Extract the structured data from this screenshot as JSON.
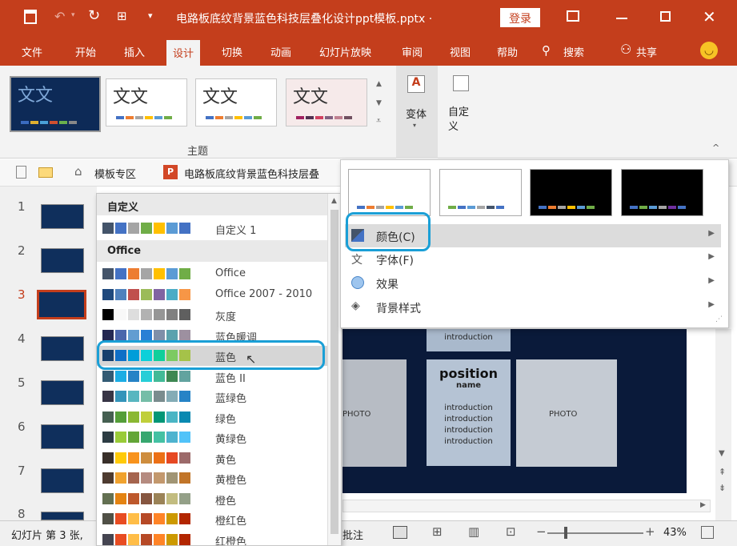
{
  "title": {
    "filename": "电路板底纹背景蓝色科技层叠化设计ppt模板.pptx ·",
    "login": "登录"
  },
  "ribbon_tabs": [
    "文件",
    "开始",
    "插入",
    "设计",
    "切换",
    "动画",
    "幻灯片放映",
    "审阅",
    "视图",
    "帮助",
    "搜索",
    "共享"
  ],
  "ribbon": {
    "group_label": "主题",
    "themes": [
      {
        "text": "文文"
      },
      {
        "text": "文文"
      },
      {
        "text": "文文"
      },
      {
        "text": "文文"
      }
    ],
    "variant_label": "变体",
    "customize_label": "自定义"
  },
  "docbar": {
    "template_zone": "模板专区",
    "doc_title": "电路板底纹背景蓝色科技层叠"
  },
  "slides": [
    "1",
    "2",
    "3",
    "4",
    "5",
    "6",
    "7",
    "8"
  ],
  "statusbar": {
    "slide_info": "幻灯片 第 3 张,",
    "notes": "批注",
    "zoom": "43%"
  },
  "color_menu": {
    "section_custom": "自定义",
    "custom_item": "自定义 1",
    "section_office": "Office",
    "items": [
      {
        "label": "Office",
        "colors": [
          "#44546a",
          "#4472c4",
          "#ed7d31",
          "#a5a5a5",
          "#ffc000",
          "#5b9bd5",
          "#70ad47"
        ]
      },
      {
        "label": "Office 2007 - 2010",
        "colors": [
          "#1f497d",
          "#4f81bd",
          "#c0504d",
          "#9bbb59",
          "#8064a2",
          "#4bacc6",
          "#f79646"
        ]
      },
      {
        "label": "灰度",
        "colors": [
          "#000000",
          "#f8f8f8",
          "#dddddd",
          "#b2b2b2",
          "#969696",
          "#808080",
          "#5f5f5f"
        ]
      },
      {
        "label": "蓝色暖调",
        "colors": [
          "#242852",
          "#4a66ac",
          "#629dd1",
          "#297fd5",
          "#7f8fa9",
          "#5aa2ae",
          "#9d90a0"
        ]
      },
      {
        "label": "蓝色",
        "colors": [
          "#17406d",
          "#0f6fc6",
          "#009dd9",
          "#0bd0d9",
          "#10cf9b",
          "#7cca62",
          "#a5c249"
        ]
      },
      {
        "label": "蓝色 II",
        "colors": [
          "#335b74",
          "#1cade4",
          "#2683c6",
          "#27ced7",
          "#42ba97",
          "#3e8853",
          "#62a39f"
        ]
      },
      {
        "label": "蓝绿色",
        "colors": [
          "#373545",
          "#3494ba",
          "#58b6c0",
          "#75bda7",
          "#7a8c8e",
          "#84acb6",
          "#2683c6"
        ]
      },
      {
        "label": "绿色",
        "colors": [
          "#455f51",
          "#549e39",
          "#8ab833",
          "#c0cf3a",
          "#029676",
          "#4ab5c4",
          "#0989b1"
        ]
      },
      {
        "label": "黄绿色",
        "colors": [
          "#2c3c43",
          "#99cb38",
          "#63a537",
          "#37a76f",
          "#44c1a3",
          "#4eb3cf",
          "#51c3f9"
        ]
      },
      {
        "label": "黄色",
        "colors": [
          "#39302a",
          "#ffca08",
          "#f8931d",
          "#ce8d3e",
          "#ec7016",
          "#e64823",
          "#9c6a6a"
        ]
      },
      {
        "label": "黄橙色",
        "colors": [
          "#4e3b30",
          "#f0a22e",
          "#a5644e",
          "#b58b80",
          "#c3986d",
          "#a19574",
          "#c17529"
        ]
      },
      {
        "label": "橙色",
        "colors": [
          "#637052",
          "#e48312",
          "#bd582c",
          "#865640",
          "#9b8357",
          "#c2bc80",
          "#94a088"
        ]
      },
      {
        "label": "橙红色",
        "colors": [
          "#505046",
          "#e84c22",
          "#ffbd47",
          "#b64926",
          "#ff8427",
          "#cc9900",
          "#b22600"
        ]
      },
      {
        "label": "红橙色",
        "colors": [
          "#454551",
          "#e84c22",
          "#ffbd47",
          "#b64926",
          "#ff8427",
          "#cc9900",
          "#b22600"
        ]
      }
    ],
    "custom_colors": [
      "#44546a",
      "#4472c4",
      "#a5a5a5",
      "#70ad47",
      "#ffc000",
      "#5b9bd5",
      "#4472c4"
    ]
  },
  "variant_menu": {
    "items": [
      "颜色(C)",
      "字体(F)",
      "效果",
      "背景样式"
    ]
  },
  "slide_content": {
    "introduction_top": "introduction",
    "position": "position",
    "name": "name",
    "photo_left": "PHOTO",
    "photo_right": "PHOTO",
    "intro_lines": [
      "introduction",
      "introduction",
      "introduction",
      "introduction"
    ]
  }
}
